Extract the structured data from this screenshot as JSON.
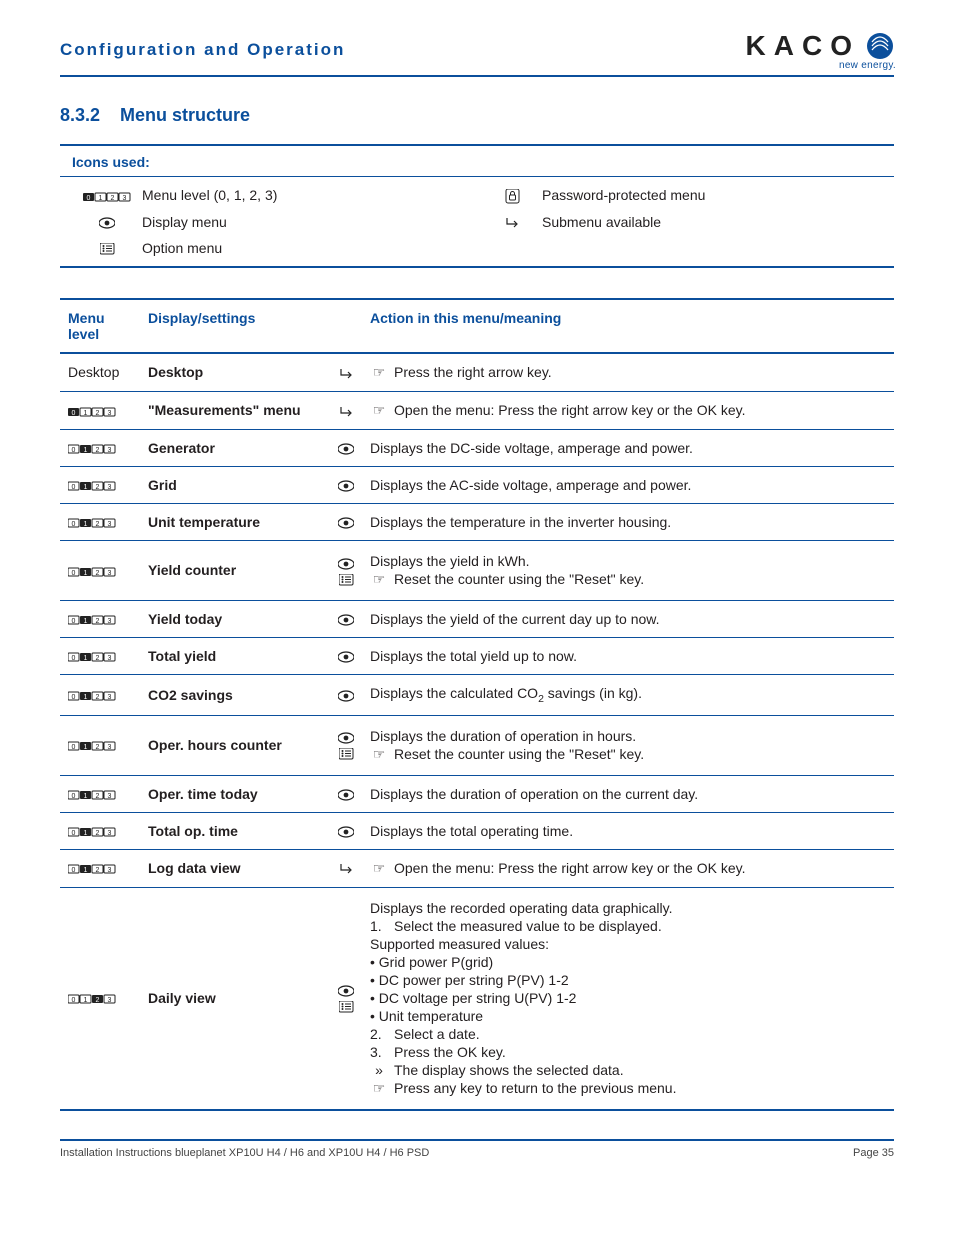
{
  "header": {
    "title": "Configuration and Operation",
    "brand": "KACO",
    "tagline": "new energy."
  },
  "section": {
    "number": "8.3.2",
    "title": "Menu structure"
  },
  "icons": {
    "title": "Icons used:",
    "items": {
      "level": "Menu level (0, 1, 2, 3)",
      "display": "Display menu",
      "option": "Option menu",
      "protected": "Password-protected menu",
      "submenu": "Submenu available"
    }
  },
  "table": {
    "headers": {
      "level": "Menu level",
      "display": "Display/settings",
      "action": "Action in this menu/meaning"
    },
    "rows": {
      "desktop": {
        "level": "Desktop",
        "name": "Desktop",
        "action": "Press the right arrow key."
      },
      "measurements": {
        "name": "\"Measurements\" menu",
        "action": "Open the menu: Press the right arrow key or the OK key."
      },
      "generator": {
        "name": "Generator",
        "action": "Displays the DC-side voltage, amperage and power."
      },
      "grid": {
        "name": "Grid",
        "action": "Displays the AC-side voltage, amperage and power."
      },
      "unittemp": {
        "name": "Unit temperature",
        "action": "Displays the temperature in the inverter housing."
      },
      "yieldcounter": {
        "name": "Yield counter",
        "line1": "Displays the yield in kWh.",
        "line2": "Reset the counter using the \"Reset\" key."
      },
      "yieldtoday": {
        "name": "Yield today",
        "action": "Displays the yield of the current day up to now."
      },
      "totalyield": {
        "name": "Total yield",
        "action": "Displays the total yield up to now."
      },
      "co2": {
        "name": "CO2 savings",
        "action_pre": "Displays the calculated CO",
        "action_post": " savings (in kg)."
      },
      "operhours": {
        "name": "Oper. hours counter",
        "line1": "Displays the duration of operation in hours.",
        "line2": "Reset the counter using the \"Reset\" key."
      },
      "opertoday": {
        "name": "Oper. time today",
        "action": "Displays the duration of operation on the current day."
      },
      "totalop": {
        "name": "Total op. time",
        "action": "Displays the total operating time."
      },
      "logdata": {
        "name": "Log data view",
        "action": "Open the menu: Press the right arrow key or the OK key."
      },
      "dailyview": {
        "name": "Daily view",
        "l1": "Displays the recorded operating data graphically.",
        "l2": "Select the measured value to be displayed.",
        "l3": "Supported measured values:",
        "b1": "Grid power P(grid)",
        "b2": "DC power per string P(PV) 1-2",
        "b3": "DC voltage per string U(PV) 1-2",
        "b4": "Unit temperature",
        "l4": "Select a date.",
        "l5": "Press the OK key.",
        "l6": "The display shows the selected data.",
        "l7": "Press any key to return to the previous menu."
      }
    }
  },
  "footer": {
    "left": "Installation Instructions blueplanet XP10U H4 / H6 and XP10U H4 / H6 PSD",
    "right": "Page 35"
  }
}
